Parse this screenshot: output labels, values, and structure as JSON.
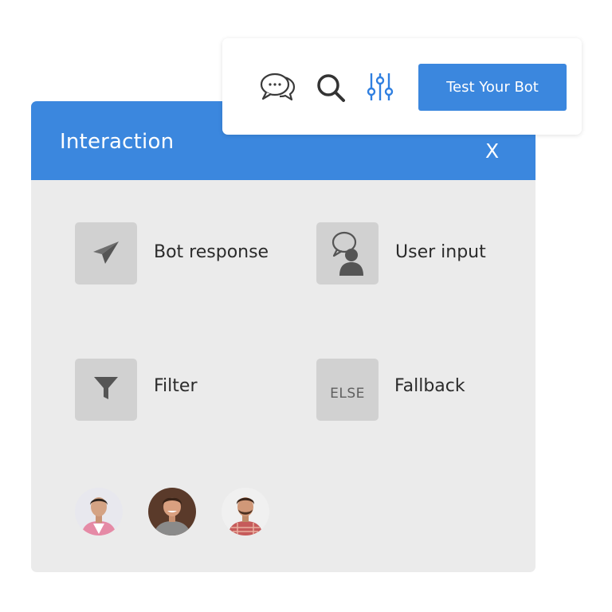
{
  "toolbar": {
    "icons": [
      "chat-bubbles-icon",
      "search-icon",
      "sliders-icon"
    ],
    "test_button_label": "Test Your Bot",
    "accent_color": "#3b87de"
  },
  "panel": {
    "title": "Interaction",
    "close_label": "X",
    "items": [
      {
        "label": "Bot response",
        "icon": "paper-plane-icon"
      },
      {
        "label": "User input",
        "icon": "user-speech-icon"
      },
      {
        "label": "Filter",
        "icon": "filter-icon"
      },
      {
        "label": "Fallback",
        "icon_text": "ELSE"
      }
    ],
    "avatars": [
      "avatar-1",
      "avatar-2",
      "avatar-3"
    ]
  }
}
